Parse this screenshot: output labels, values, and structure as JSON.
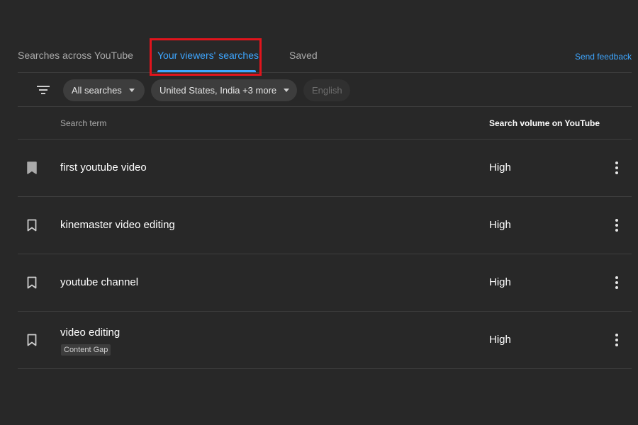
{
  "tabs": [
    {
      "label": "Searches across YouTube",
      "active": false
    },
    {
      "label": "Your viewers' searches",
      "active": true
    },
    {
      "label": "Saved",
      "active": false
    }
  ],
  "send_feedback": "Send feedback",
  "filters": {
    "icon": "filter-icon",
    "chips": [
      {
        "label": "All searches",
        "has_dropdown": true
      },
      {
        "label": "United States, India +3 more",
        "has_dropdown": true
      },
      {
        "label": "English",
        "disabled": true
      }
    ]
  },
  "table": {
    "columns": [
      "Search term",
      "Search volume on YouTube"
    ],
    "rows": [
      {
        "term": "first youtube video",
        "volume": "High",
        "saved": true
      },
      {
        "term": "kinemaster video editing",
        "volume": "High",
        "saved": false
      },
      {
        "term": "youtube channel",
        "volume": "High",
        "saved": false
      },
      {
        "term": "video editing",
        "volume": "High",
        "saved": false,
        "badge": "Content Gap"
      }
    ]
  },
  "colors": {
    "background": "#282828",
    "accent": "#3ea6ff",
    "highlight": "#e1141c",
    "chip": "#3d3d3d"
  }
}
